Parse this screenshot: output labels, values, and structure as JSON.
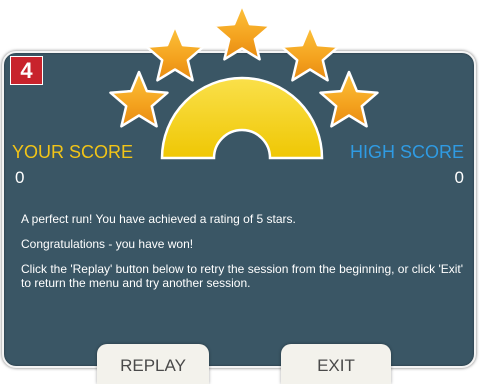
{
  "badge": {
    "level": "4"
  },
  "rating": {
    "stars_earned": 5,
    "stars_total": 5
  },
  "scores": {
    "your_label": "YOUR SCORE",
    "your_value": "0",
    "high_label": "HIGH SCORE",
    "high_value": "0"
  },
  "message": {
    "line1": "A perfect run! You have achieved a rating of 5 stars.",
    "line2": "Congratulations - you have won!",
    "line3": "Click the 'Replay' button below to retry the session from the beginning, or click 'Exit' to return the menu and try another session."
  },
  "buttons": {
    "replay_label": "REPLAY",
    "exit_label": "EXIT"
  },
  "colors": {
    "panel": "#3a5665",
    "badge": "#c8232c",
    "arc": "#f6d10a",
    "star": "#f4a620",
    "your_score": "#f2c417",
    "high_score": "#2f9be3"
  }
}
